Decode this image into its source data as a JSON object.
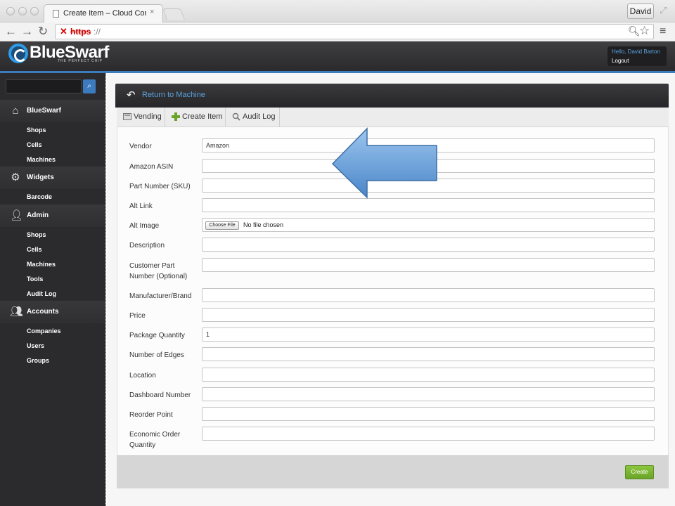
{
  "browser": {
    "tab_title": "Create Item – Cloud Contro",
    "tab_close": "×",
    "user_button": "David",
    "url_scheme": "https",
    "url_rest": "://",
    "icons": [
      "back-icon",
      "forward-icon",
      "reload-icon",
      "zoom-icon",
      "star-icon",
      "menu-icon"
    ]
  },
  "app": {
    "logo_text": "BlueSwarf",
    "logo_tagline": "THE PERFECT CHIP",
    "greeting": "Hello, David Barton",
    "logout": "Logout",
    "brand_color": "#3d7bbf"
  },
  "sidebar": {
    "sections": [
      {
        "label": "BlueSwarf",
        "icon": "home-icon",
        "items": [
          "Shops",
          "Cells",
          "Machines"
        ]
      },
      {
        "label": "Widgets",
        "icon": "gear-icon",
        "items": [
          "Barcode"
        ]
      },
      {
        "label": "Admin",
        "icon": "user-icon",
        "items": [
          "Shops",
          "Cells",
          "Machines",
          "Tools",
          "Audit Log"
        ]
      },
      {
        "label": "Accounts",
        "icon": "users-icon",
        "items": [
          "Companies",
          "Users",
          "Groups"
        ]
      }
    ]
  },
  "main": {
    "return_label": "Return to Machine",
    "tabs": [
      "Vending",
      "Create Item",
      "Audit Log"
    ],
    "fields": [
      {
        "label": "Vendor",
        "value": "Amazon"
      },
      {
        "label": "Amazon ASIN",
        "value": ""
      },
      {
        "label": "Part Number (SKU)",
        "value": ""
      },
      {
        "label": "Alt Link",
        "value": ""
      },
      {
        "label": "Alt Image",
        "value": ""
      },
      {
        "label": "Description",
        "value": ""
      },
      {
        "label": "Customer Part Number (Optional)",
        "value": ""
      },
      {
        "label": "Manufacturer/Brand",
        "value": ""
      },
      {
        "label": "Price",
        "value": ""
      },
      {
        "label": "Package Quantity",
        "value": "1"
      },
      {
        "label": "Number of Edges",
        "value": ""
      },
      {
        "label": "Location",
        "value": ""
      },
      {
        "label": "Dashboard Number",
        "value": ""
      },
      {
        "label": "Reorder Point",
        "value": ""
      },
      {
        "label": "Economic Order Quantity",
        "value": ""
      }
    ],
    "file_button": "Choose File",
    "file_status": "No file chosen",
    "create_label": "Create",
    "create_color": "#7ab535",
    "callout_arrow_color": "#5b9bd5"
  }
}
